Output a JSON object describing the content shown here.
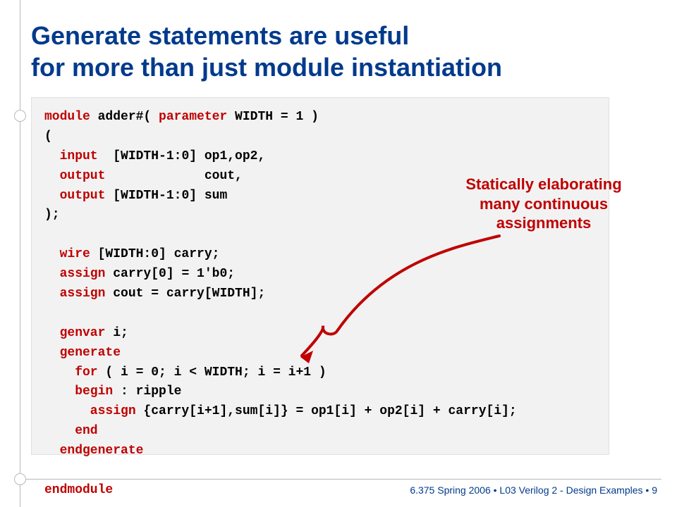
{
  "title_line1": "Generate statements are useful",
  "title_line2": "for more than just module instantiation",
  "code": {
    "l1a": "module",
    "l1b": " adder#( ",
    "l1c": "parameter",
    "l1d": " WIDTH = 1 )",
    "l2": "(",
    "l3a": "  input",
    "l3b": "  [WIDTH-1:0] op1,op2,",
    "l4a": "  output",
    "l4b": "             cout,",
    "l5a": "  output",
    "l5b": " [WIDTH-1:0] sum",
    "l6": ");",
    "l7a": "  wire",
    "l7b": " [WIDTH:0] carry;",
    "l8a": "  assign",
    "l8b": " carry[0] = 1'b0;",
    "l9a": "  assign",
    "l9b": " cout = carry[WIDTH];",
    "l10a": "  genvar",
    "l10b": " i;",
    "l11a": "  generate",
    "l12a": "    for",
    "l12b": " ( i = 0; i < WIDTH; i = i+1 )",
    "l13a": "    begin",
    "l13b": " : ripple",
    "l14a": "      assign",
    "l14b": " {carry[i+1],sum[i]} = op1[i] + op2[i] + carry[i];",
    "l15a": "    end",
    "l16a": "  endgenerate",
    "l17a": "endmodule"
  },
  "annotation": {
    "l1": "Statically elaborating",
    "l2": "many continuous",
    "l3": "assignments"
  },
  "footer": "6.375 Spring 2006 • L03 Verilog 2 - Design Examples • 9"
}
